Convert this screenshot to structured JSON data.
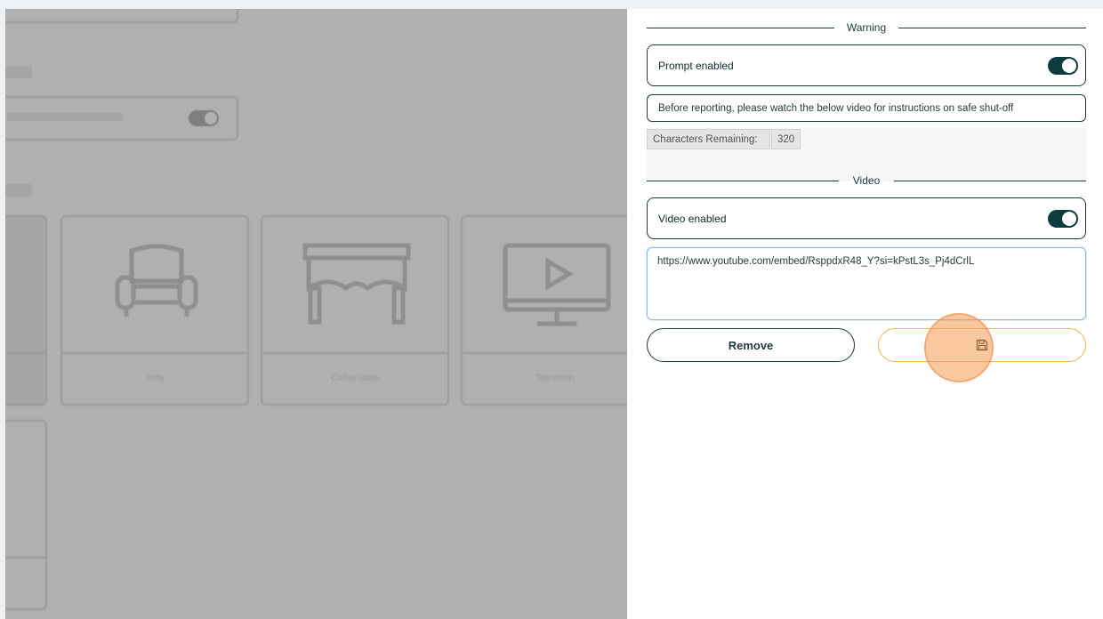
{
  "background": {
    "card_labels": [
      "Sofa",
      "Coffee table",
      "Television"
    ]
  },
  "panel": {
    "warning_section_title": "Warning",
    "prompt_toggle_label": "Prompt enabled",
    "prompt_text": "Before reporting, please watch the below video for instructions on safe shut-off",
    "characters_remaining_label": "Characters Remaining:",
    "characters_remaining_value": "320",
    "video_section_title": "Video",
    "video_toggle_label": "Video enabled",
    "video_url": "https://www.youtube.com/embed/RsppdxR48_Y?si=kPstL3s_Pj4dCrlL",
    "remove_button_label": "Remove",
    "save_icon": "floppy-disk-icon",
    "toggle_color": "#0e3b3e",
    "accent_color": "#f0b14a"
  }
}
